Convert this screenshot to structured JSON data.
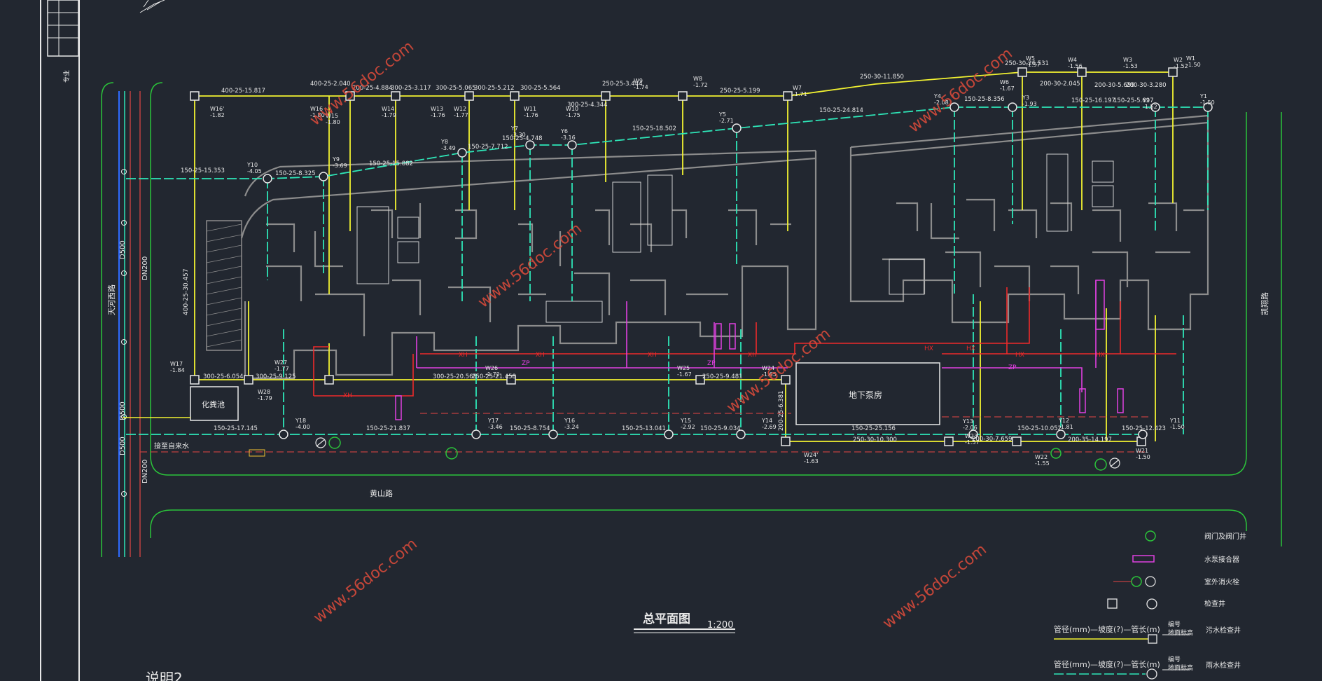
{
  "drawing": {
    "title": "总平面图",
    "scale": "1:200",
    "note_partial": "说明2"
  },
  "watermark": "www.56doc.com",
  "roads": {
    "left": "天河西路",
    "bottom": "黄山路",
    "right": "凯翔路"
  },
  "buildings": {
    "pump_room": "地下泵房",
    "septic_tank": "化粪池",
    "connect_note": "接至自来水"
  },
  "pipes_left": [
    "D500",
    "DN200",
    "D500",
    "D500",
    "DN200"
  ],
  "legend": [
    {
      "label": "阀门及阀门井"
    },
    {
      "label": "水泵接合器"
    },
    {
      "label": "室外消火栓"
    },
    {
      "label": "检查井"
    },
    {
      "label": "污水检查井",
      "formula": "管径(mm)—坡度(?)—管长(m)",
      "sub1": "编号",
      "sub2": "地面标高"
    },
    {
      "label": "雨水检查井",
      "formula": "管径(mm)—坡度(?)—管长(m)",
      "sub1": "编号",
      "sub2": "地面标高"
    }
  ],
  "labels": {
    "top_sewer": [
      {
        "pipe": "400-25-15.817",
        "well": "W16'",
        "elev": "-1.82"
      },
      {
        "pipe": "400-25-2.040",
        "well": "W16",
        "elev": "-1.80"
      },
      {
        "pipe": "200-25-4.884",
        "well": "W15",
        "elev": "-1.80"
      },
      {
        "pipe": "300-25-3.117",
        "well": "W14",
        "elev": "-1.79"
      },
      {
        "pipe": "300-25-5.065",
        "well": "W13",
        "elev": "-1.76"
      },
      {
        "pipe": "300-25-5.212",
        "well": "W12",
        "elev": "-1.77"
      },
      {
        "pipe": "300-25-5.564",
        "well": "W11",
        "elev": "-1.76"
      },
      {
        "pipe": "300-25-4.344",
        "well": "W10",
        "elev": "-1.75"
      },
      {
        "pipe": "250-25-3.444",
        "well": "W9",
        "elev": "-1.74"
      },
      {
        "pipe": "250-25-5.199",
        "well": "W8",
        "elev": "-1.72"
      },
      {
        "pipe": "250-30-11.850",
        "well": "W7",
        "elev": "-1.71"
      },
      {
        "pipe": "250-30-26.531",
        "well": "W6",
        "elev": "-1.67"
      },
      {
        "pipe": "200-30-2.045",
        "well": "W5",
        "elev": "-1.57"
      },
      {
        "pipe": "200-30-5.659",
        "well": "W4",
        "elev": "-1.56"
      },
      {
        "pipe": "200-30-3.280",
        "well": "W3",
        "elev": "-1.53"
      },
      {
        "pipe": "200-35-6.590",
        "well": "W2",
        "elev": "-1.52"
      },
      {
        "pipe": "",
        "well": "W1",
        "elev": "-1.50"
      }
    ],
    "top_rain": [
      {
        "pipe": "150-25-15.353",
        "well": "Y10",
        "elev": "-4.05"
      },
      {
        "pipe": "150-25-8.325",
        "well": "Y9",
        "elev": "-3.69"
      },
      {
        "pipe": "150-25-15.882",
        "well": "Y8",
        "elev": "-3.49"
      },
      {
        "pipe": "150-25-7.712",
        "well": "Y7",
        "elev": "-3.30"
      },
      {
        "pipe": "150-25-4.748",
        "well": "Y6",
        "elev": "-3.16"
      },
      {
        "pipe": "150-25-18.502",
        "well": "Y5",
        "elev": "-2.71"
      },
      {
        "pipe": "150-25-24.814",
        "well": "Y4",
        "elev": "-2.08"
      },
      {
        "pipe": "150-25-8.356",
        "well": "Y3",
        "elev": "-1.93"
      },
      {
        "pipe": "150-25-16.197",
        "well": "Y2",
        "elev": "-1.52"
      },
      {
        "pipe": "150-25-5.697",
        "well": "Y1",
        "elev": "-1.50"
      }
    ],
    "bottom_sewer": [
      {
        "pipe": "300-25-6.054",
        "well": "W17",
        "elev": "-1.84"
      },
      {
        "pipe": "300-25-9.125",
        "well": "W28",
        "elev": "-1.79"
      },
      {
        "pipe": "300-25-20.565",
        "well": "W27",
        "elev": "-1.77"
      },
      {
        "pipe": "250-25-21.458",
        "well": "W26",
        "elev": "-1.72"
      },
      {
        "pipe": "250-25-9.481",
        "well": "W25",
        "elev": "-1.67"
      },
      {
        "pipe": "200-25-6.381",
        "well": "W24",
        "elev": "-1.65"
      },
      {
        "pipe": "250-30-10.300",
        "well": "W24'",
        "elev": "-1.63"
      },
      {
        "pipe": "200-30-7.659",
        "well": "W23",
        "elev": "-1.57"
      },
      {
        "pipe": "200-35-14.197",
        "well": "W22",
        "elev": "-1.55"
      },
      {
        "pipe": "",
        "well": "W21",
        "elev": "-1.50"
      }
    ],
    "bottom_rain": [
      {
        "pipe": "150-25-17.145",
        "well": "Y18",
        "elev": "-4.00"
      },
      {
        "pipe": "150-25-21.837",
        "well": "Y17",
        "elev": "-3.46"
      },
      {
        "pipe": "150-25-8.754",
        "well": "Y16",
        "elev": "-3.24"
      },
      {
        "pipe": "150-25-13.041",
        "well": "Y15",
        "elev": "-2.92"
      },
      {
        "pipe": "150-25-9.034",
        "well": "Y14",
        "elev": "-2.69"
      },
      {
        "pipe": "150-25-25.156",
        "well": "Y13",
        "elev": "-2.06"
      },
      {
        "pipe": "150-25-10.052",
        "well": "Y12",
        "elev": "-1.81"
      },
      {
        "pipe": "150-25-12.423",
        "well": "Y11",
        "elev": "-1.50"
      }
    ],
    "left_pipe": "400-25-30.457",
    "pipe_codes": {
      "fire": "XH",
      "pump": "ZP",
      "hydrant": "HX"
    }
  }
}
